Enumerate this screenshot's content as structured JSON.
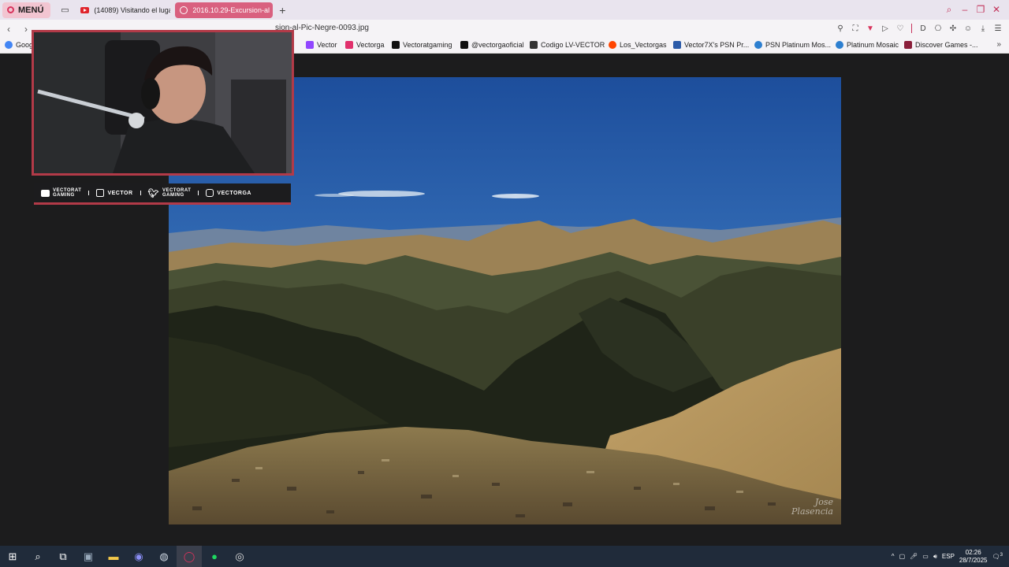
{
  "browser": {
    "menu_label": "MENÚ",
    "tabs": [
      {
        "label": "(14089) Visitando el lugar"
      },
      {
        "label": "2016.10.29-Excursion-al"
      }
    ],
    "url": "sion-al-Pic-Negre-0093.jpg",
    "bookmarks": [
      {
        "label": "Goog",
        "color": "#4285f4"
      },
      {
        "label": "Vector",
        "color": "#9146ff"
      },
      {
        "label": "Vectorga",
        "color": "#e1306c"
      },
      {
        "label": "Vectoratgaming",
        "color": "#111111"
      },
      {
        "label": "@vectorgaoficial",
        "color": "#111111"
      },
      {
        "label": "Codigo LV-VECTOR",
        "color": "#333333"
      },
      {
        "label": "Los_Vectorgas",
        "color": "#ff4500"
      },
      {
        "label": "Vector7X's PSN Pr...",
        "color": "#2b5aa8"
      },
      {
        "label": "PSN Platinum Mos...",
        "color": "#2d7fd0"
      },
      {
        "label": "Platinum Mosaic",
        "color": "#2d7fd0"
      },
      {
        "label": "Discover Games -...",
        "color": "#8a1e3a"
      }
    ]
  },
  "photo": {
    "signature_line1": "Jose",
    "signature_line2": "Plasencia"
  },
  "stream": {
    "socials": [
      {
        "top": "VECTORAT",
        "bottom": "GAMING"
      },
      {
        "top": "",
        "bottom": "VECTOR"
      },
      {
        "top": "VECTORAT",
        "bottom": "GAMING"
      },
      {
        "top": "",
        "bottom": "VECTORGA"
      }
    ]
  },
  "taskbar": {
    "language": "ESP",
    "time": "02:26",
    "date": "28/7/2025",
    "notification_count": "3"
  }
}
